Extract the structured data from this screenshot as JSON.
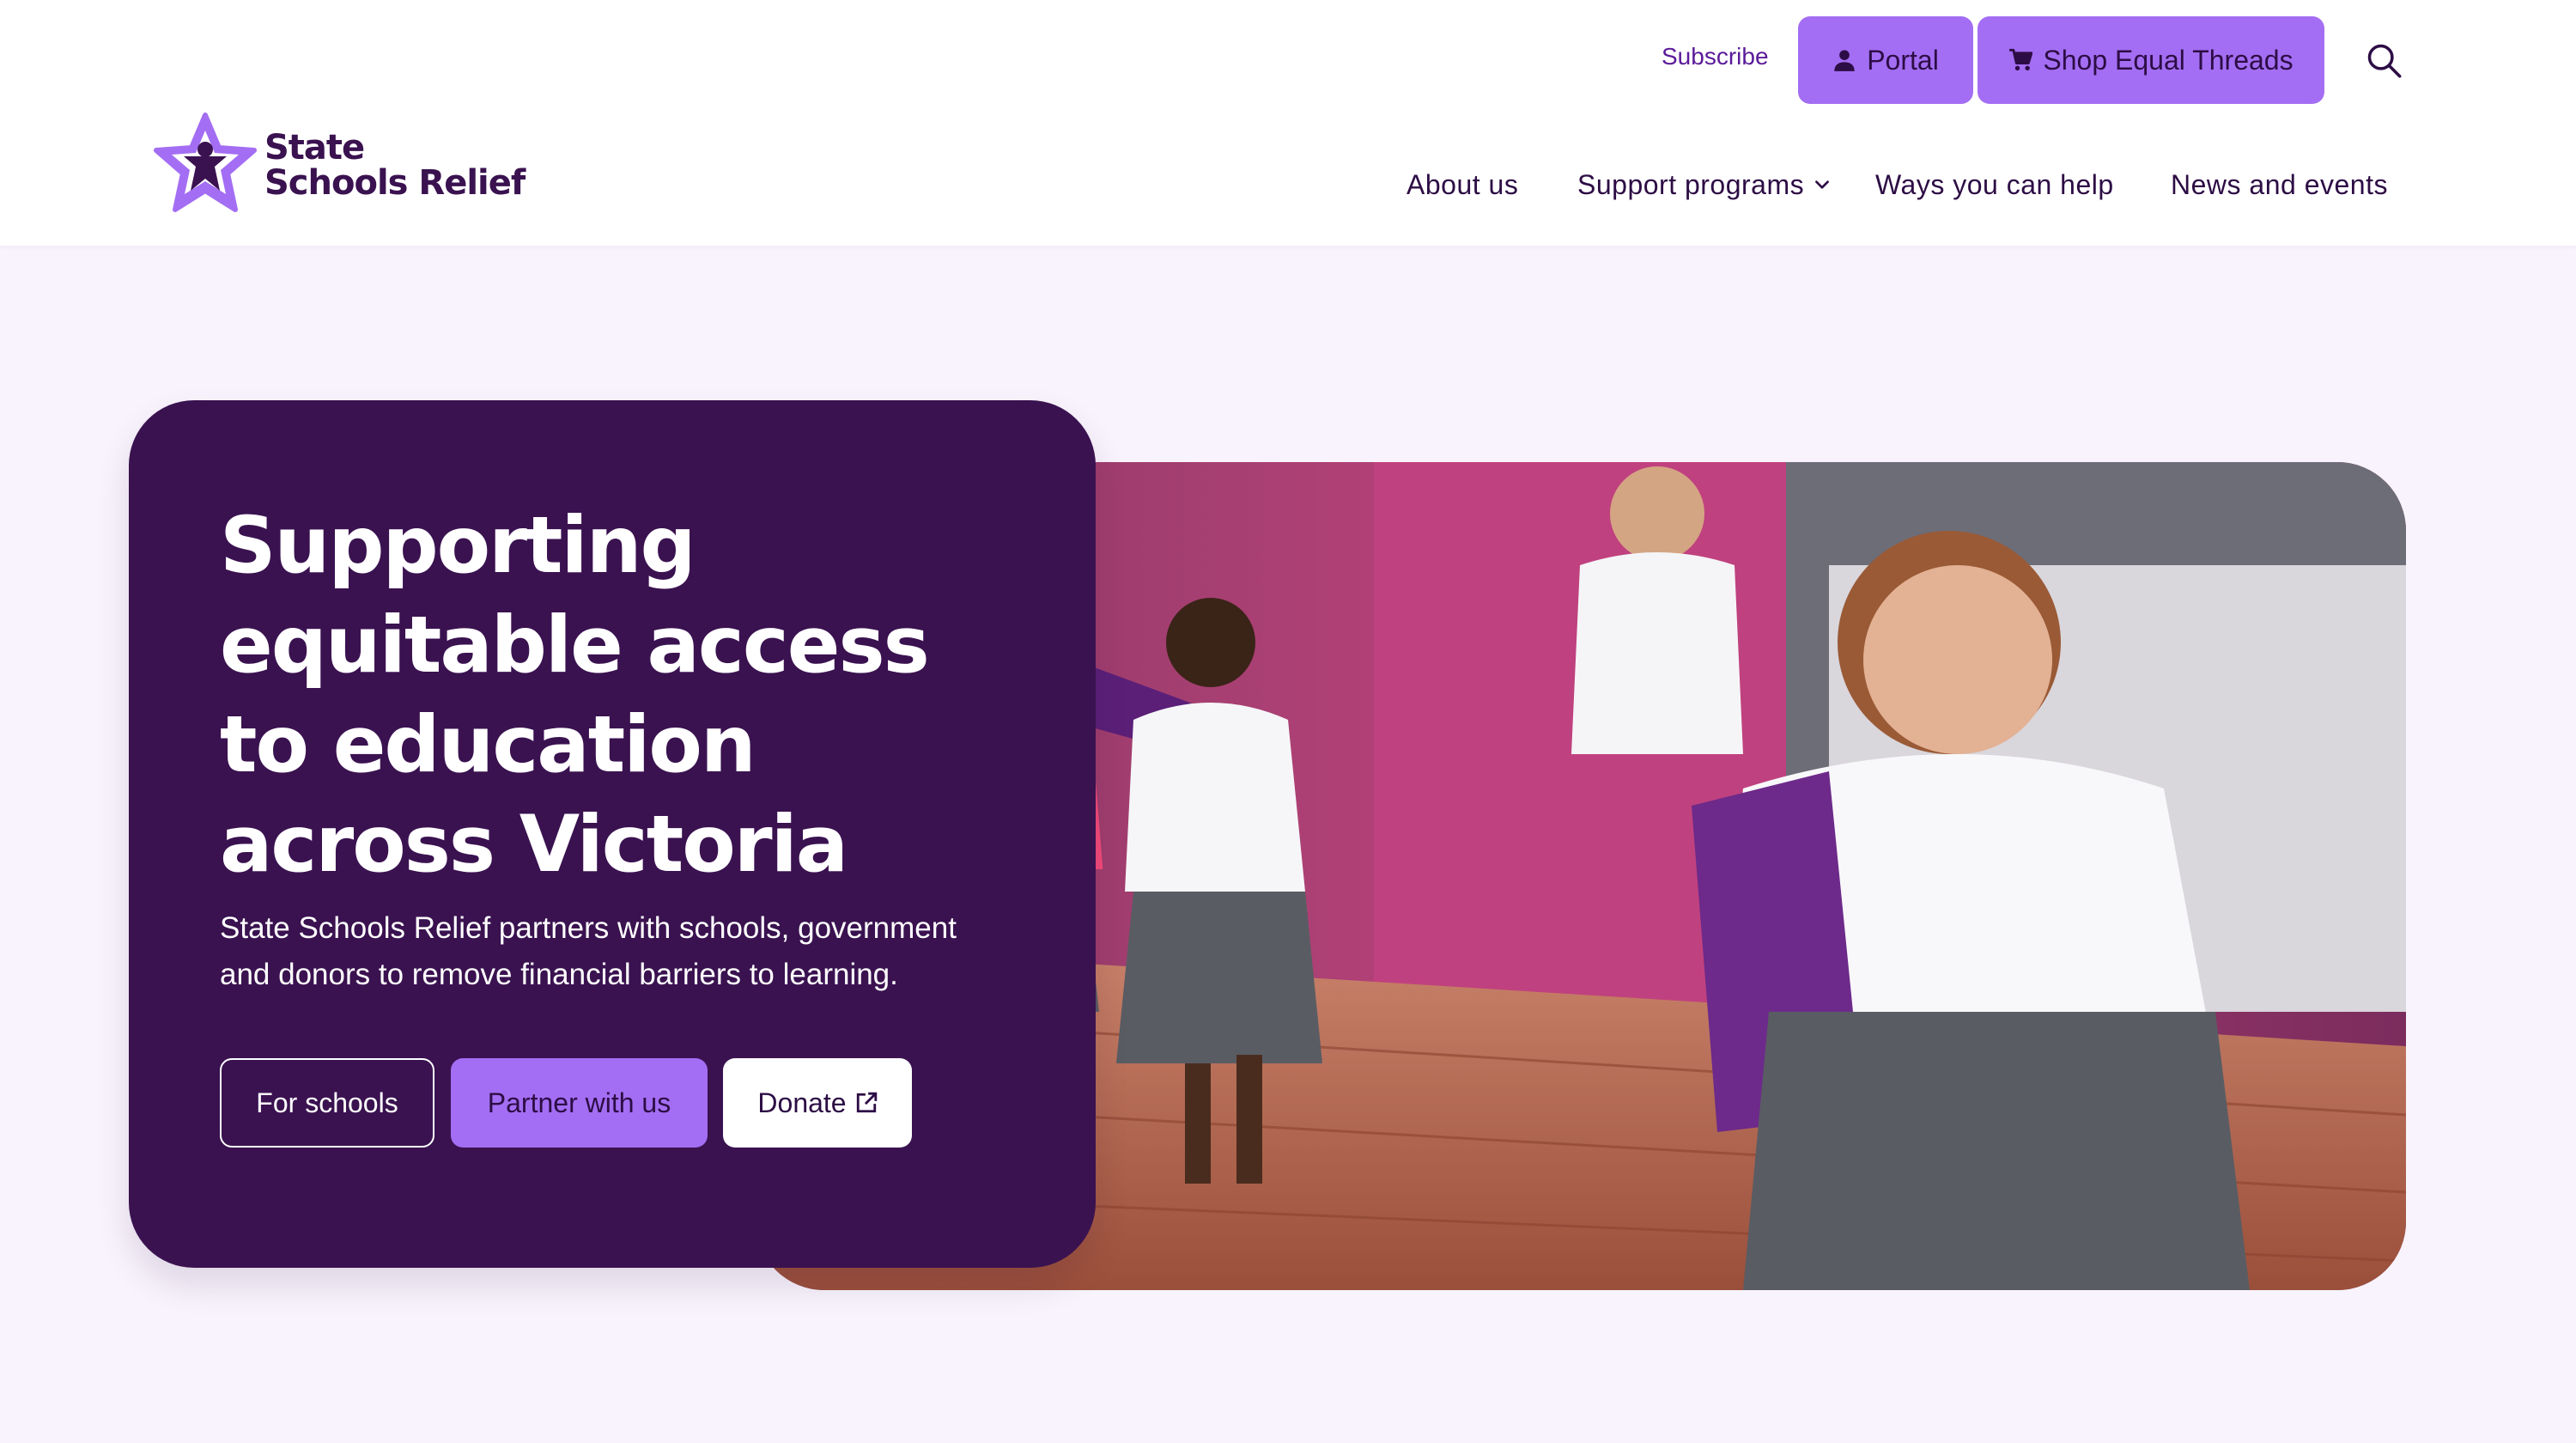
{
  "brand": {
    "name_line1": "State",
    "name_line2": "Schools Relief",
    "colors": {
      "deep_purple": "#3a1250",
      "accent_purple": "#a36ef3",
      "light_background": "#f8f3fc",
      "logo_star": "#a36ef3"
    }
  },
  "utility_nav": {
    "subscribe_label": "Subscribe",
    "portal_label": "Portal",
    "portal_icon": "user-icon",
    "shop_label": "Shop Equal Threads",
    "shop_icon": "cart-icon",
    "search_icon": "search-icon"
  },
  "main_nav": {
    "items": [
      {
        "label": "About us"
      },
      {
        "label": "Support programs",
        "icon": "chevron-down-icon"
      },
      {
        "label": "Ways you can help"
      },
      {
        "label": "News and events"
      }
    ]
  },
  "hero": {
    "title": "Supporting equitable access to education across Victoria",
    "subtitle": "State Schools Relief partners with schools, government and donors to remove financial barriers to learning.",
    "buttons": {
      "for_schools": "For schools",
      "partner": "Partner with us",
      "donate": "Donate",
      "donate_icon": "external-link-icon"
    }
  }
}
